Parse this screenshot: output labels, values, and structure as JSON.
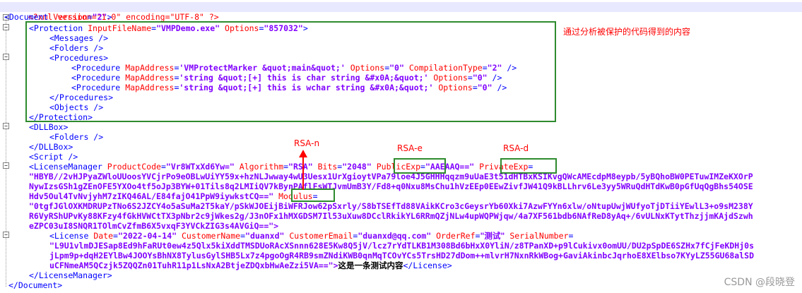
{
  "lines": {
    "l1_pi": "<?xml version=\"1.0\" encoding=\"UTF-8\" ?>",
    "l2_open": "<Document",
    "l2_attr": "Version",
    "l2_val": "\"2\"",
    "l2_close": ">",
    "l3_tag": "<Protection",
    "l3_attr1": "InputFileName",
    "l3_val1": "\"VMPDemo.exe\"",
    "l3_attr2": "Options",
    "l3_val2": "\"857032\"",
    "l3_close": ">",
    "l4": "<Messages />",
    "l5": "<Folders />",
    "l6": "<Procedures>",
    "l7_tag": "<Procedure",
    "l7_attr1": "MapAddress",
    "l7_val1": "'VMProtectMarker &quot;main&quot;'",
    "l7_attr2": "Options",
    "l7_val2": "\"0\"",
    "l7_attr3": "CompilationType",
    "l7_val3": "\"2\"",
    "l7_close": "/>",
    "l8_tag": "<Procedure",
    "l8_attr1": "MapAddress",
    "l8_val1": "'string &quot;[+] this is char string &#x0A;&quot;'",
    "l8_attr2": "Options",
    "l8_val2": "\"0\"",
    "l8_close": "/>",
    "l9_tag": "<Procedure",
    "l9_attr1": "MapAddress",
    "l9_val1": "'string &quot;[+] this is wchar string &#x0A;&quot;'",
    "l9_attr2": "Options",
    "l9_val2": "\"0\"",
    "l9_close": "/>",
    "l10": "</Procedures>",
    "l11": "<Objects />",
    "l12": "</Protection>",
    "l13": "<DLLBox>",
    "l14": "<Folders />",
    "l15": "</DLLBox>",
    "l16": "<Script />",
    "l17_tag": "<LicenseManager",
    "l17_attr1": "ProductCode",
    "l17_val1": "\"Vr8WTxXd6Yw=\"",
    "l17_attr2": "Algorithm",
    "l17_val2": "\"RSA\"",
    "l17_attr3": "Bits",
    "l17_val3": "\"2048\"",
    "l17_attr4": "PublicExp",
    "l17_val4": "\"AAEAAQ==\"",
    "l17_attr5": "PrivateExp",
    "l17_eq": "=",
    "l18": "\"HBYB//2vHJPyaZWloUUoosYVCjrPo9eOBLwUiYY59x+hzNLJwway4wU3Uesx1UrXgioytVPa79loe4J5GHHHqqzm9uUaE3t51dHTBxKSIKvgQWcAMEcdpM8eypb/5yBQhoBW0PETuwIMZeKXOrP",
    "l19": "NywIzsGSh1gZEnOFE5YXOo4tf5oJp3BYW+01Tils8q2LMIiQV7kBynPAflFsWTJvmUmB3Y/Fd8+q0Nxu8MsChu1hVzEEp0EEwZivfJW41Q9kBLLhrv6Le3yy5WRuQdHTdKwB0pGfUqQgBhs54OSE",
    "l20_val": "Hdv5Oul4TvNvjyhM7zIKQ46AL/E84fajO41PpW9iywkstCQ==\"",
    "l20_attr": "Modulus",
    "l20_eq": "=",
    "l21": "\"0tgfJGlOXKMDRUPzTNo6S2JZCY4o5aSuMa2T5kaY/pSkWJOEijBiWFRJow62pSxrly/S8bTSEfTd88VAikKCro3cGeysrYb60Xki7AzwFYYn6xlw/oNtupUwjWUfyoTjDTiiYEwlL3+o9sM238Y",
    "l22": "R6VyRShUPvKy88KFzy4fGkHVWCtTX3pNbr2c9jWkes2g/J3nOFx1hMXGDSM7Il53uXuw8DCclRkikYL6RRmQZjNLw4upWQPWjqw/4a7XF561bdb6NAfReD8yAq+/6vULNxKTytThzjjmKAjdSzwh",
    "l23": "eZPC03uI8SNQR1TOlmCvZfmB6X5vxqF3YVCkZIG3s4AVGiQ==\">",
    "l24_tag": "<License",
    "l24_attr1": "Date",
    "l24_val1": "\"2022-04-14\"",
    "l24_attr2": "CustomerName",
    "l24_val2": "\"duanxd\"",
    "l24_attr3": "CustomerEmail",
    "l24_val3": "\"duanxd@qq.com\"",
    "l24_attr4": "OrderRef",
    "l24_val4": "\"测试\"",
    "l24_attr5": "SerialNumber",
    "l24_eq": "=",
    "l25": "\"L9U1vlmDJESap8Ed9hFaRUt0ew4z5Qlx5kiXddTMSDUoRAcXSnnn628E5Kw8Q5jV/lcz7rYdTLKB1M308Bd6bHxX0YliN/z8TPanXD+p9lCukivx0omUU/DU2pSpDE6SZHx7fCjFeKDHj0s",
    "l26": "jLpm9p+dqH2EYlBw4JOOYsBhNX8TylusGylSHB5Lx7z4pgoOgR4RB9smZNdiKWB0qnMqTCOvYCs5TrsHD27dDom++mlvrH7NxnRkWBog+GaviAkinbcJqrhoE8XElbso7KYyLZ55GU68alSD",
    "l27_val": "uCFNmeAM5QCzjk5ZQQZn01TuhR11p1LsNxA2BtjeZDQxbHwAeZzi5VA==\">",
    "l27_text": "这是一条测试内容",
    "l27_close": "</License>",
    "l28": "</LicenseManager>",
    "l29": "</Document>"
  },
  "annotations": {
    "protection_note": "通过分析被保护的代码得到的内容",
    "rsa_n": "RSA-n",
    "rsa_e": "RSA-e",
    "rsa_d": "RSA-d"
  },
  "watermark": "CSDN @段晓登",
  "colors": {
    "tag": "#0000ff",
    "attr": "#ff0000",
    "value": "#8000ff",
    "annotation": "#ff0000",
    "box": "#2e8b2e"
  },
  "icons": {
    "fold_open": "minus-box",
    "arrow": "up-arrow"
  }
}
